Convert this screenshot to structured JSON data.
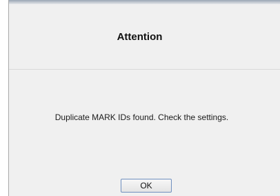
{
  "dialog": {
    "title": "Attention",
    "message": "Duplicate MARK IDs found. Check the settings.",
    "ok_label": "OK"
  }
}
